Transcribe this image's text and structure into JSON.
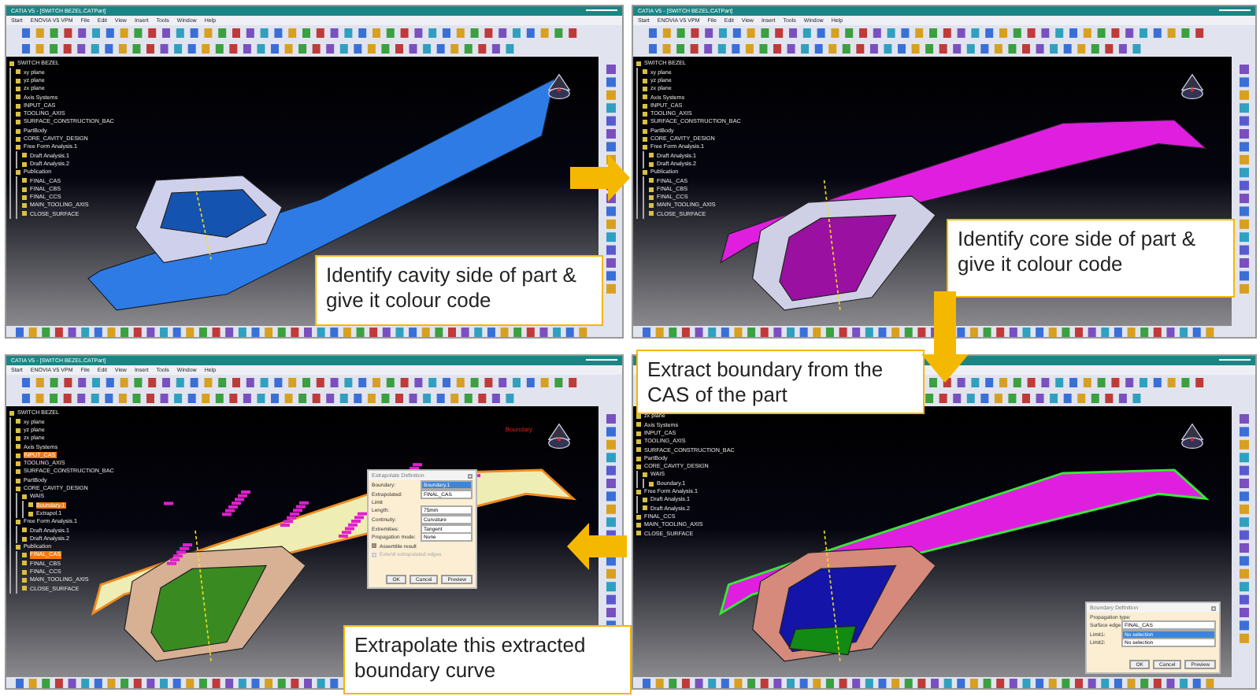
{
  "panels": [
    {
      "kind": "cavity",
      "title": "CATIA V5 - [SWITCH BEZEL.CATPart]",
      "menu": [
        "Start",
        "ENOVIA V5 VPM",
        "File",
        "Edit",
        "View",
        "Insert",
        "Tools",
        "Window",
        "Help"
      ],
      "tree": [
        {
          "label": "SWITCH BEZEL",
          "selected": false,
          "children": [
            {
              "label": "xy plane",
              "selected": false
            },
            {
              "label": "yz plane",
              "selected": false
            },
            {
              "label": "zx plane",
              "selected": false
            },
            {
              "label": "Axis Systems",
              "selected": false
            },
            {
              "label": "INPUT_CAS",
              "selected": false
            },
            {
              "label": "TOOLING_AXIS",
              "selected": false
            },
            {
              "label": "SURFACE_CONSTRUCTION_BAC",
              "selected": false
            },
            {
              "label": "PartBody",
              "selected": false
            },
            {
              "label": "CORE_CAVITY_DESIGN",
              "selected": false
            },
            {
              "label": "Free Form Analysis.1",
              "selected": false,
              "children": [
                {
                  "label": "Draft Analysis.1",
                  "selected": false
                },
                {
                  "label": "Draft Analysis.2",
                  "selected": false
                }
              ]
            },
            {
              "label": "Publication",
              "selected": false,
              "children": [
                {
                  "label": "FINAL_CAS",
                  "selected": false
                },
                {
                  "label": "FINAL_CBS",
                  "selected": false
                },
                {
                  "label": "FINAL_CCS",
                  "selected": false
                },
                {
                  "label": "MAIN_TOOLING_AXIS",
                  "selected": false
                },
                {
                  "label": "CLOSE_SURFACE",
                  "selected": false
                }
              ]
            }
          ]
        }
      ],
      "callout": "Identify cavity side of part & give it colour code"
    },
    {
      "kind": "core",
      "title": "CATIA V5 - [SWITCH BEZEL.CATPart]",
      "menu": [
        "Start",
        "ENOVIA V5 VPM",
        "File",
        "Edit",
        "View",
        "Insert",
        "Tools",
        "Window",
        "Help"
      ],
      "tree": [
        {
          "label": "SWITCH BEZEL",
          "selected": false,
          "children": [
            {
              "label": "xy plane",
              "selected": false
            },
            {
              "label": "yz plane",
              "selected": false
            },
            {
              "label": "zx plane",
              "selected": false
            },
            {
              "label": "Axis Systems",
              "selected": false
            },
            {
              "label": "INPUT_CAS",
              "selected": false
            },
            {
              "label": "TOOLING_AXIS",
              "selected": false
            },
            {
              "label": "SURFACE_CONSTRUCTION_BAC",
              "selected": false
            },
            {
              "label": "PartBody",
              "selected": false
            },
            {
              "label": "CORE_CAVITY_DESIGN",
              "selected": false
            },
            {
              "label": "Free Form Analysis.1",
              "selected": false,
              "children": [
                {
                  "label": "Draft Analysis.1",
                  "selected": false
                },
                {
                  "label": "Draft Analysis.2",
                  "selected": false
                }
              ]
            },
            {
              "label": "Publication",
              "selected": false,
              "children": [
                {
                  "label": "FINAL_CAS",
                  "selected": false
                },
                {
                  "label": "FINAL_CBS",
                  "selected": false
                },
                {
                  "label": "FINAL_CCS",
                  "selected": false
                },
                {
                  "label": "MAIN_TOOLING_AXIS",
                  "selected": false
                },
                {
                  "label": "CLOSE_SURFACE",
                  "selected": false
                }
              ]
            }
          ]
        }
      ],
      "callout": "Identify core side of part & give it colour code"
    },
    {
      "kind": "extrapolate",
      "title": "CATIA V5 - [SWITCH BEZEL.CATPart]",
      "menu": [
        "Start",
        "ENOVIA V5 VPM",
        "File",
        "Edit",
        "View",
        "Insert",
        "Tools",
        "Window",
        "Help"
      ],
      "tree": [
        {
          "label": "SWITCH BEZEL",
          "selected": false,
          "children": [
            {
              "label": "xy plane",
              "selected": false
            },
            {
              "label": "yz plane",
              "selected": false
            },
            {
              "label": "zx plane",
              "selected": false
            },
            {
              "label": "Axis Systems",
              "selected": false
            },
            {
              "label": "INPUT_CAS",
              "selected": true
            },
            {
              "label": "TOOLING_AXIS",
              "selected": false
            },
            {
              "label": "SURFACE_CONSTRUCTION_BAC",
              "selected": false
            },
            {
              "label": "PartBody",
              "selected": false
            },
            {
              "label": "CORE_CAVITY_DESIGN",
              "selected": false,
              "children": [
                {
                  "label": "WAIS",
                  "selected": false,
                  "children": [
                    {
                      "label": "Boundary.1",
                      "selected": true
                    },
                    {
                      "label": "Extrapol.1",
                      "selected": false
                    }
                  ]
                }
              ]
            },
            {
              "label": "Free Form Analysis.1",
              "selected": false,
              "children": [
                {
                  "label": "Draft Analysis.1",
                  "selected": false
                },
                {
                  "label": "Draft Analysis.2",
                  "selected": false
                }
              ]
            },
            {
              "label": "Publication",
              "selected": false,
              "children": [
                {
                  "label": "FINAL_CAS",
                  "selected": true
                },
                {
                  "label": "FINAL_CBS",
                  "selected": false
                },
                {
                  "label": "FINAL_CCS",
                  "selected": false
                },
                {
                  "label": "MAIN_TOOLING_AXIS",
                  "selected": false
                },
                {
                  "label": "CLOSE_SURFACE",
                  "selected": false
                }
              ]
            }
          ]
        }
      ],
      "label": "Boundary",
      "dialog": {
        "kind": "extrapolate",
        "title": "Extrapolate Definition",
        "fields": [
          {
            "label": "Boundary:",
            "value": "Boundary.1",
            "selected": true
          },
          {
            "label": "Extrapolated:",
            "value": "FINAL_CAS",
            "selected": false
          }
        ],
        "group": "Limit",
        "length": {
          "label": "Length:",
          "value": "75mm"
        },
        "combos": [
          {
            "label": "Continuity:",
            "value": "Curvature"
          },
          {
            "label": "Extremities:",
            "value": "Tangent"
          },
          {
            "label": "Propagation mode:",
            "value": "None"
          }
        ],
        "checks": [
          {
            "label": "Assemble result",
            "checked": true,
            "disabled": false
          },
          {
            "label": "Extend extrapolated edges",
            "checked": false,
            "disabled": true
          }
        ],
        "buttons": [
          "OK",
          "Cancel",
          "Preview"
        ]
      },
      "callout": "Extrapolate this extracted boundary curve"
    },
    {
      "kind": "boundary",
      "tree": [
        {
          "label": "zx plane",
          "selected": false
        },
        {
          "label": "Axis Systems",
          "selected": false
        },
        {
          "label": "INPUT_CAS",
          "selected": false
        },
        {
          "label": "TOOLING_AXIS",
          "selected": false
        },
        {
          "label": "SURFACE_CONSTRUCTION_BAC",
          "selected": false
        },
        {
          "label": "PartBody",
          "selected": false
        },
        {
          "label": "CORE_CAVITY_DESIGN",
          "selected": false,
          "children": [
            {
              "label": "WAIS",
              "selected": false,
              "children": [
                {
                  "label": "Boundary.1",
                  "selected": false
                }
              ]
            }
          ]
        },
        {
          "label": "Free Form Analysis.1",
          "selected": false,
          "children": [
            {
              "label": "Draft Analysis.1",
              "selected": false
            },
            {
              "label": "Draft Analysis.2",
              "selected": false
            }
          ]
        },
        {
          "label": "FINAL_CCS",
          "selected": false
        },
        {
          "label": "MAIN_TOOLING_AXIS",
          "selected": false
        },
        {
          "label": "CLOSE_SURFACE",
          "selected": false
        }
      ],
      "dialog": {
        "kind": "boundary",
        "title": "Boundary Definition",
        "group": "Propagation type:",
        "fields": [
          {
            "label": "Surface edge:",
            "value": "FINAL_CAS",
            "selected": false
          },
          {
            "label": "Limit1:",
            "value": "No selection",
            "selected": true
          },
          {
            "label": "Limit2:",
            "value": "No selection",
            "selected": false
          }
        ],
        "buttons": [
          "OK",
          "Cancel",
          "Preview"
        ]
      },
      "callout": "Extract boundary from the CAS of the part"
    }
  ],
  "arrows": [
    {
      "kind": "right"
    },
    {
      "kind": "down"
    },
    {
      "kind": "left"
    }
  ]
}
